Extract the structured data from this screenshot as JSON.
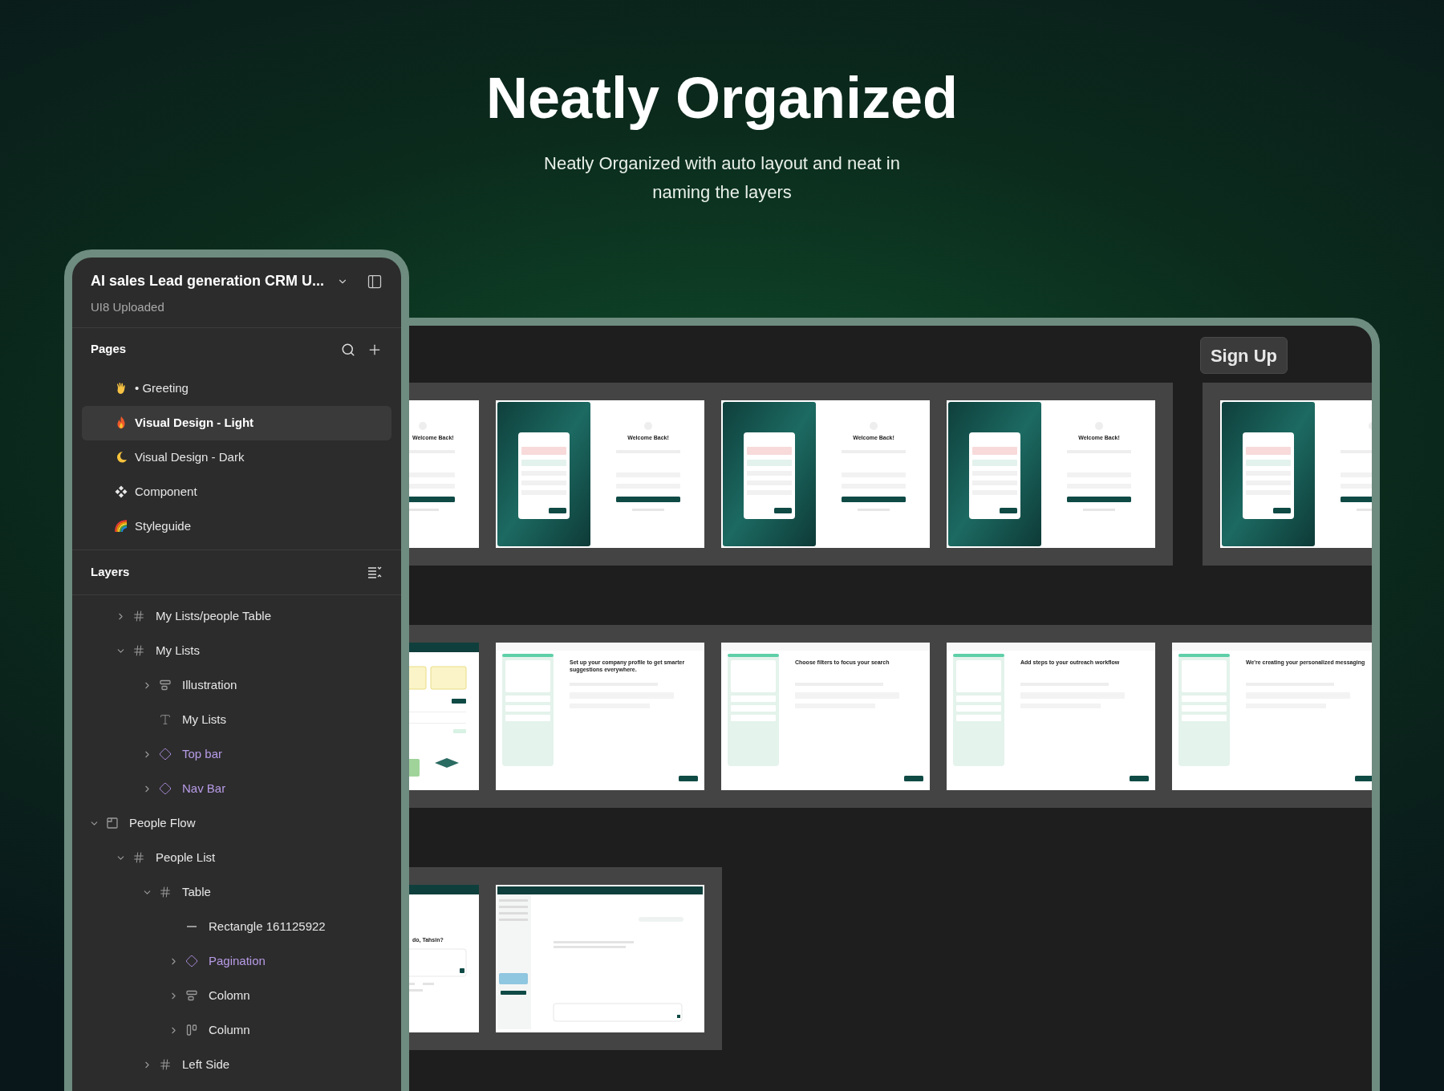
{
  "hero": {
    "title": "Neatly Organized",
    "subtitle": "Neatly Organized with auto layout and neat in naming the layers"
  },
  "file": {
    "name": "AI sales Lead generation CRM U...",
    "team": "UI8 Uploaded"
  },
  "pages": {
    "title": "Pages",
    "items": [
      {
        "kind": "hand",
        "label": "• Greeting",
        "selected": false
      },
      {
        "kind": "flame",
        "label": "Visual Design - Light",
        "selected": true
      },
      {
        "kind": "moon",
        "label": "Visual Design - Dark",
        "selected": false
      },
      {
        "kind": "component",
        "label": "Component",
        "selected": false
      },
      {
        "kind": "rainbow",
        "label": "Styleguide",
        "selected": false
      }
    ]
  },
  "layers": {
    "title": "Layers",
    "items": [
      {
        "kind": "offscreen-parent",
        "children": [
          {
            "kind": "frame",
            "name": "My Lists/people Table",
            "expanded": false
          },
          {
            "kind": "frame",
            "name": "My Lists",
            "expanded": true,
            "children": [
              {
                "kind": "autolayout-vertical",
                "name": "Illustration",
                "expanded": false
              },
              {
                "kind": "text",
                "name": "My Lists"
              },
              {
                "kind": "component",
                "name": "Top bar",
                "expanded": false
              },
              {
                "kind": "component",
                "name": "Nav Bar",
                "expanded": false
              }
            ]
          }
        ]
      },
      {
        "kind": "section",
        "name": "People Flow",
        "expanded": true,
        "children": [
          {
            "kind": "frame",
            "name": "People List",
            "expanded": true,
            "children": [
              {
                "kind": "frame",
                "name": "Table",
                "expanded": true,
                "children": [
                  {
                    "kind": "line",
                    "name": "Rectangle 161125922"
                  },
                  {
                    "kind": "component",
                    "name": "Pagination",
                    "expanded": false
                  },
                  {
                    "kind": "autolayout-vertical",
                    "name": "Colomn",
                    "expanded": false
                  },
                  {
                    "kind": "autolayout-horizontal",
                    "name": "Column",
                    "expanded": false
                  }
                ]
              },
              {
                "kind": "frame",
                "name": "Left Side",
                "expanded": false
              }
            ]
          }
        ]
      }
    ]
  },
  "canvas": {
    "button": "Sign Up",
    "rows": [
      {
        "sections": [
          {
            "frames": [
              {
                "kind": "login",
                "title": "Welcome Back!"
              },
              {
                "kind": "login",
                "title": "Welcome Back!"
              },
              {
                "kind": "login",
                "title": "Welcome Back!"
              },
              {
                "kind": "login",
                "title": "Welcome Back!"
              }
            ]
          },
          {
            "frames": [
              {
                "kind": "login"
              }
            ]
          }
        ]
      },
      {
        "sections": [
          {
            "frames": [
              {
                "kind": "dashboard"
              },
              {
                "kind": "onboarding",
                "title": "Set up your company profile to get smarter suggestions everywhere."
              },
              {
                "kind": "onboarding",
                "title": "Choose filters to focus your search"
              },
              {
                "kind": "onboarding",
                "title": "Add steps to your outreach workflow"
              },
              {
                "kind": "onboarding",
                "title": "We're creating your personalized messaging"
              }
            ]
          }
        ]
      },
      {
        "sections": [
          {
            "frames": [
              {
                "kind": "greeting",
                "title": "do, Tahsin?"
              },
              {
                "kind": "chat"
              }
            ]
          }
        ]
      }
    ]
  }
}
